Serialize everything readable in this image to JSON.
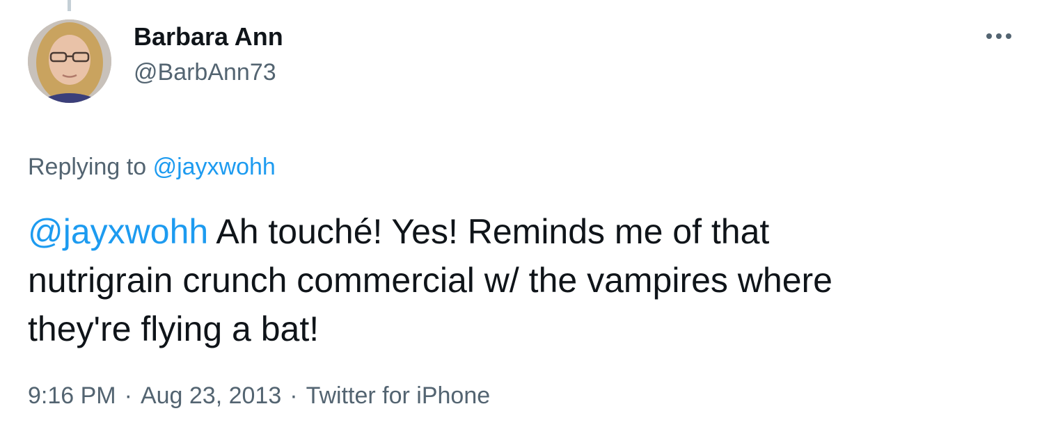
{
  "tweet": {
    "author": {
      "name": "Barbara Ann",
      "handle": "@BarbAnn73",
      "avatar_icon": "profile-photo"
    },
    "more_icon": "more-dots-icon",
    "replying": {
      "prefix": "Replying to",
      "mention": "@jayxwohh"
    },
    "text": {
      "mention": "@jayxwohh",
      "line1": " Ah touché! Yes! Reminds me of that",
      "line2": "nutrigrain crunch commercial w/ the vampires where",
      "line3": "they're flying a bat!"
    },
    "meta": {
      "time": "9:16 PM",
      "separator": "·",
      "date": "Aug 23, 2013",
      "source": "Twitter for iPhone"
    }
  },
  "colors": {
    "text_primary": "#0f1419",
    "text_secondary": "#536471",
    "link": "#1d9bf0",
    "thread_line": "#c4cfd6"
  }
}
